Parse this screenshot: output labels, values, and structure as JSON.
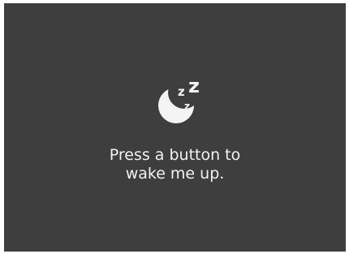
{
  "screen": {
    "background_color": "#3e3e3e",
    "icon": "sleeping-moon-zzz-icon",
    "message_lines": [
      "Press a button to",
      "wake me up."
    ]
  }
}
